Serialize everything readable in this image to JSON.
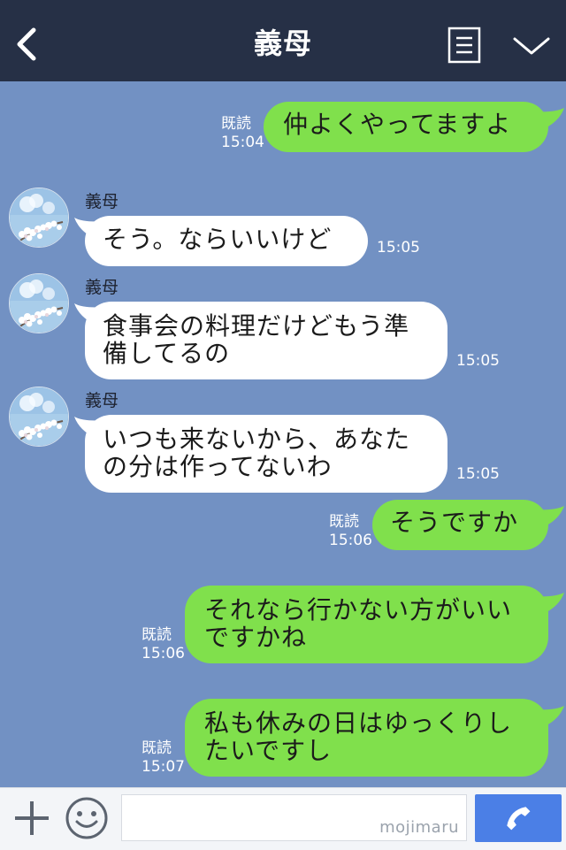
{
  "header": {
    "title": "義母"
  },
  "messages": [
    {
      "side": "right",
      "read": "既読",
      "time": "15:04",
      "text": "仲よくやってますよ"
    },
    {
      "side": "left",
      "sender": "義母",
      "time": "15:05",
      "text": "そう。ならいいけど"
    },
    {
      "side": "left",
      "sender": "義母",
      "time": "15:05",
      "text": "食事会の料理だけどもう準\n備してるの"
    },
    {
      "side": "left",
      "sender": "義母",
      "time": "15:05",
      "text": "いつも来ないから、あなた\nの分は作ってないわ"
    },
    {
      "side": "right",
      "read": "既読",
      "time": "15:06",
      "text": "そうですか"
    },
    {
      "side": "right",
      "read": "既読",
      "time": "15:06",
      "text": "それなら行かない方がいい\nですかね"
    },
    {
      "side": "right",
      "read": "既読",
      "time": "15:07",
      "text": "私も休みの日はゆっくりし\nたいですし"
    }
  ],
  "footer": {
    "watermark": "mojimaru"
  },
  "icons": [
    "back-arrow-icon",
    "menu-list-icon",
    "chevron-down-icon",
    "plus-icon",
    "smiley-icon",
    "phone-icon"
  ],
  "colors": {
    "header_bg": "#263046",
    "chat_bg": "#7291c3",
    "sent_bubble": "#80e04c",
    "received_bubble": "#ffffff",
    "call_button": "#4b7fe6"
  }
}
